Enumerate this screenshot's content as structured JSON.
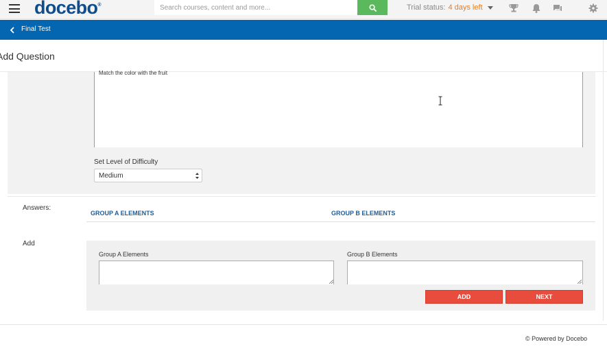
{
  "header": {
    "logo_text": "docebo",
    "logo_mark": "®",
    "search_placeholder": "Search courses, content and more...",
    "trial_label": "Trial status:",
    "trial_days": "4 days left",
    "icons": [
      "menu-icon",
      "search-icon",
      "trophy-icon",
      "bell-icon",
      "chat-icon",
      "gear-icon"
    ],
    "accent_green": "#5cb85c"
  },
  "nav": {
    "breadcrumb": "Final Test",
    "bar_color": "#0466b0"
  },
  "page": {
    "title": "Add Question"
  },
  "question": {
    "text": "Match the color with the fruit",
    "difficulty_label": "Set Level of Difficulty",
    "difficulty_value": "Medium"
  },
  "answers": {
    "label": "Answers:",
    "group_a_header": "GROUP A ELEMENTS",
    "group_b_header": "GROUP B ELEMENTS"
  },
  "add_section": {
    "label": "Add",
    "group_a_label": "Group A Elements",
    "group_b_label": "Group B Elements",
    "group_a_value": "",
    "group_b_value": "",
    "add_button": "ADD",
    "next_button": "NEXT",
    "button_color": "#e74c3c"
  },
  "footer": {
    "text": "© Powered by Docebo"
  }
}
